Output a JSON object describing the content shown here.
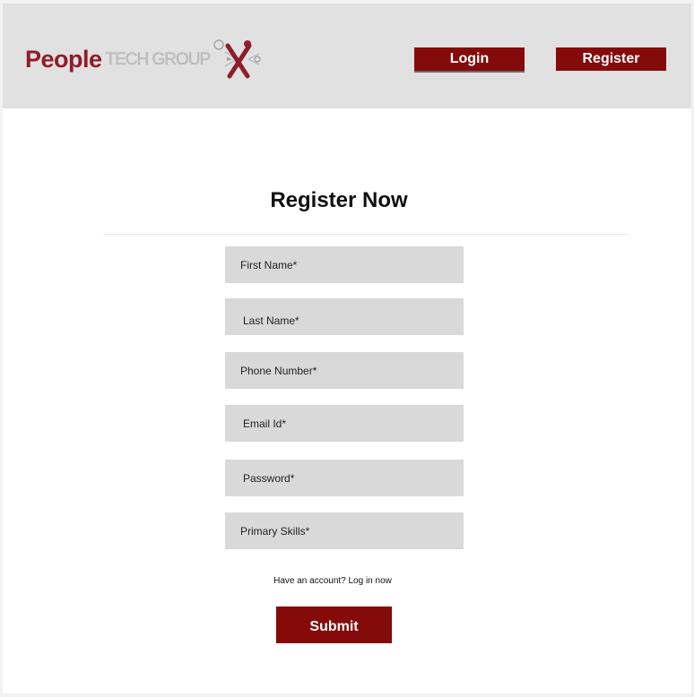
{
  "brand": {
    "name_primary": "People",
    "name_secondary": "TECH GROUP",
    "colors": {
      "primary": "#8e1e2a",
      "button": "#850b0b",
      "header_bg": "#e1e1e1",
      "field_bg": "#d9d9d9"
    }
  },
  "header": {
    "login_label": "Login",
    "register_label": "Register"
  },
  "form": {
    "title": "Register Now",
    "fields": {
      "first_name": {
        "placeholder": "First Name*",
        "value": ""
      },
      "last_name": {
        "placeholder": "Last Name*",
        "value": ""
      },
      "phone": {
        "placeholder": "Phone Number*",
        "value": ""
      },
      "email": {
        "placeholder": "Email Id*",
        "value": ""
      },
      "password": {
        "placeholder": "Password*",
        "value": ""
      },
      "skills": {
        "placeholder": "Primary Skills*",
        "value": ""
      }
    },
    "account_prompt": "Have an account? Log in now",
    "submit_label": "Submit"
  }
}
